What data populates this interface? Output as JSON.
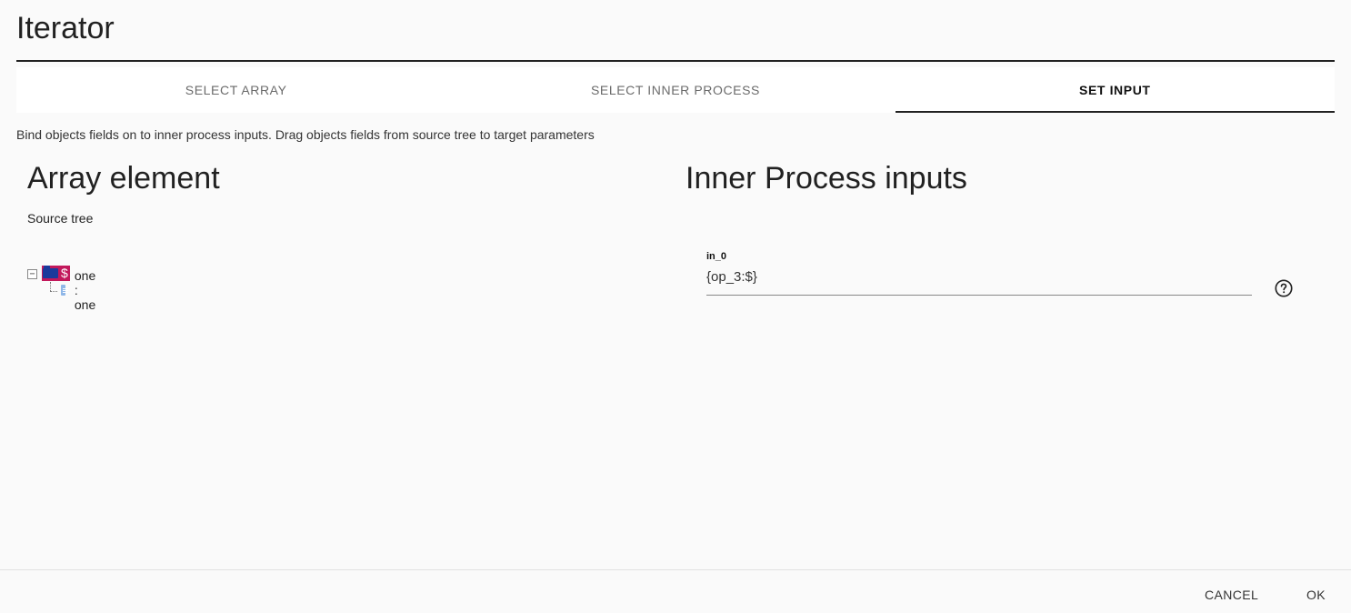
{
  "dialog": {
    "title": "Iterator"
  },
  "tabs": [
    {
      "label": "SELECT ARRAY",
      "active": false
    },
    {
      "label": "SELECT INNER PROCESS",
      "active": false
    },
    {
      "label": "SET INPUT",
      "active": true
    }
  ],
  "instructions": "Bind objects fields on to inner process inputs. Drag objects fields from source tree to target parameters",
  "left_panel": {
    "heading": "Array element",
    "source_label": "Source tree",
    "tree": {
      "root": {
        "label": "$",
        "expander": "−",
        "icon": "folder-icon",
        "highlight_color": "#c2185b"
      },
      "children": [
        {
          "label": "one : one",
          "icon": "file-icon"
        }
      ]
    }
  },
  "right_panel": {
    "heading": "Inner Process inputs",
    "inputs": [
      {
        "label": "in_0",
        "value": "{op_3:$}",
        "help_icon": "help-circle-icon"
      }
    ]
  },
  "footer": {
    "cancel_label": "CANCEL",
    "ok_label": "OK"
  }
}
